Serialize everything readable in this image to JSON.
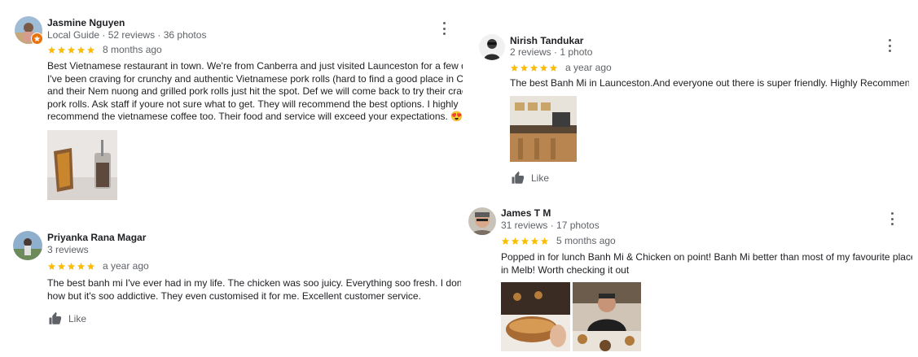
{
  "colors": {
    "star": "#fbbc04",
    "like": "#5f6368",
    "badge": "#e8710a"
  },
  "reviews": [
    {
      "name": "Jasmine Nguyen",
      "meta": "Local Guide · 52 reviews · 36 photos",
      "stars": 5,
      "ago": "8 months ago",
      "text": [
        "Best Vietnamese restaurant in town. We're from Canberra and just visited Launceston for a few days.",
        "I've been craving for crunchy and authentic Vietnamese pork rolls (hard to find a good place in CBR  )",
        "and their Nem nuong and grilled pork rolls just hit the spot. Def we will come back to try their cracking",
        "pork rolls. Ask staff if youre not sure what to get. They will recommend the best options. I highly",
        "recommend the vietnamese coffee too. Their food and service will exceed your expectations. 😍"
      ]
    },
    {
      "name": "Priyanka Rana Magar",
      "meta": "3 reviews",
      "stars": 5,
      "ago": "a year ago",
      "text": [
        "The best banh mi I've ever had in my life. The chicken was soo juicy. Everything soo fresh. I don't k",
        "how but it's soo addictive. They even customised it for me. Excellent customer service."
      ],
      "like_label": "Like"
    },
    {
      "name": "Nirish Tandukar",
      "meta": "2 reviews · 1 photo",
      "stars": 5,
      "ago": "a year ago",
      "text": [
        "The best Banh Mi in Launceston.And everyone out there is super friendly. Highly Recommended 👍"
      ],
      "like_label": "Like"
    },
    {
      "name": "James T M",
      "meta": "31 reviews · 17 photos",
      "stars": 5,
      "ago": "5 months ago",
      "text": [
        "Popped in for lunch Banh Mi & Chicken on point! Banh Mi better than most of my favourite places back",
        "in Melb! Worth checking it out"
      ]
    }
  ]
}
